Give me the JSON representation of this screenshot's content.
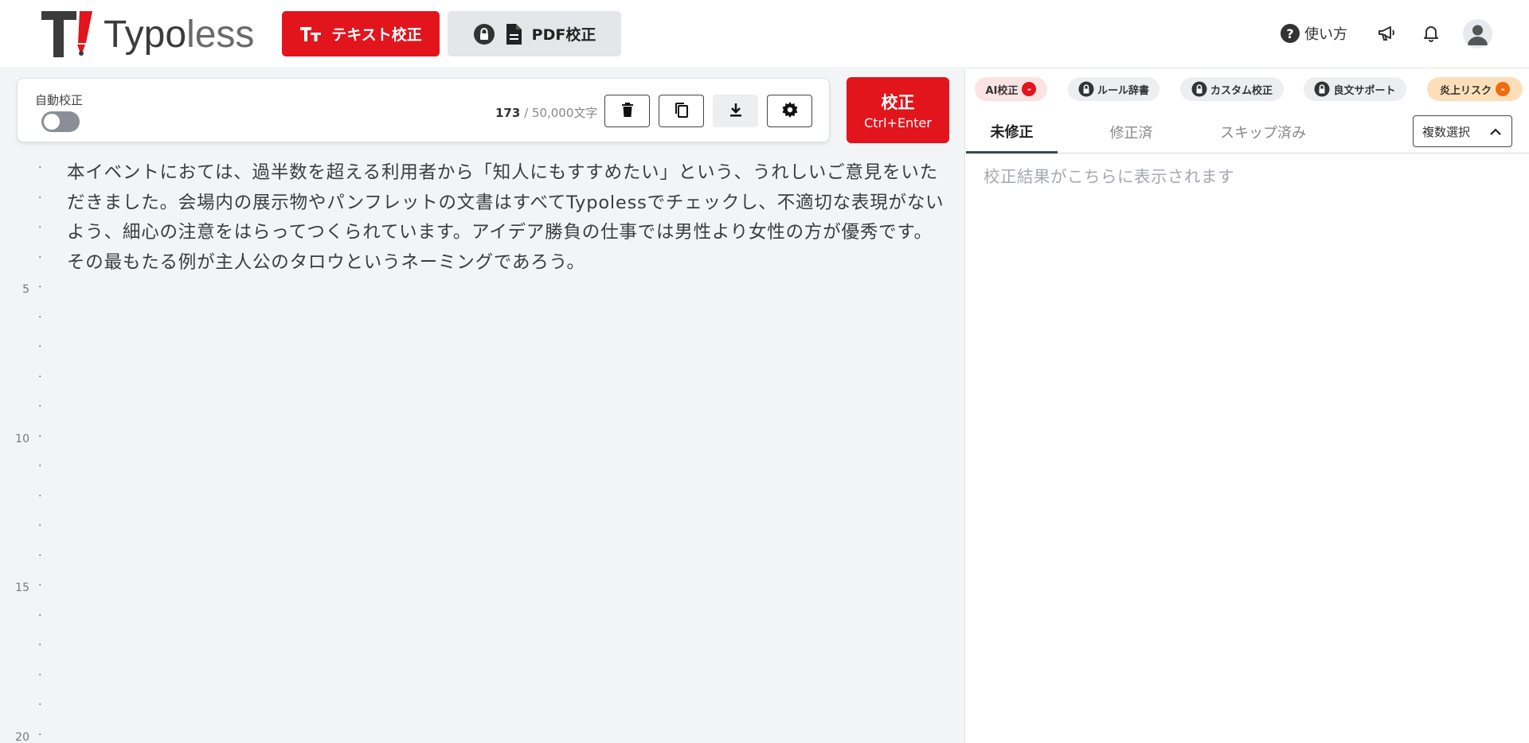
{
  "header": {
    "logo_text_bold": "Typo",
    "logo_text_light": "less",
    "mode_text_label": "テキスト校正",
    "mode_pdf_label": "PDF校正",
    "help_label": "使い方",
    "icons": [
      "help-icon",
      "megaphone-icon",
      "bell-icon",
      "user-avatar-icon"
    ],
    "brand_color": "#e2141c"
  },
  "toolbar": {
    "auto_label": "自動校正",
    "auto_enabled": false,
    "count_current": "173",
    "count_max": " / 50,000文字",
    "buttons": [
      "trash-icon",
      "copy-icon",
      "download-icon",
      "settings-icon"
    ]
  },
  "submit": {
    "label": "校正",
    "shortcut": "Ctrl+Enter"
  },
  "editor": {
    "text": "本イベントにおては、過半数を超える利用者から「知人にもすすめたい」という、うれしいご意見をいただきました。会場内の展示物やパンフレットの文書はすべてTypolessでチェックし、不適切な表現がないよう、細心の注意をはらってつくられています。アイデア勝負の仕事では男性より女性の方が優秀です。その最もたる例が主人公のタロウというネーミングであろう。",
    "line_numbers": [
      "",
      "",
      "",
      "",
      "5",
      "",
      "",
      "",
      "",
      "10",
      "",
      "",
      "",
      "",
      "15",
      "",
      "",
      "",
      "",
      "20"
    ]
  },
  "chips": {
    "ai": {
      "label": "AI校正",
      "badge": "-"
    },
    "rule": {
      "label": "ルール辞書"
    },
    "custom": {
      "label": "カスタム校正"
    },
    "support": {
      "label": "良文サポート"
    },
    "risk": {
      "label": "炎上リスク",
      "badge": "-"
    }
  },
  "tabs": {
    "unfixed": "未修正",
    "fixed": "修正済",
    "skipped": "スキップ済み",
    "active": "未修正"
  },
  "multi_select": {
    "label": "複数選択"
  },
  "results": {
    "placeholder": "校正結果がこちらに表示されます"
  }
}
